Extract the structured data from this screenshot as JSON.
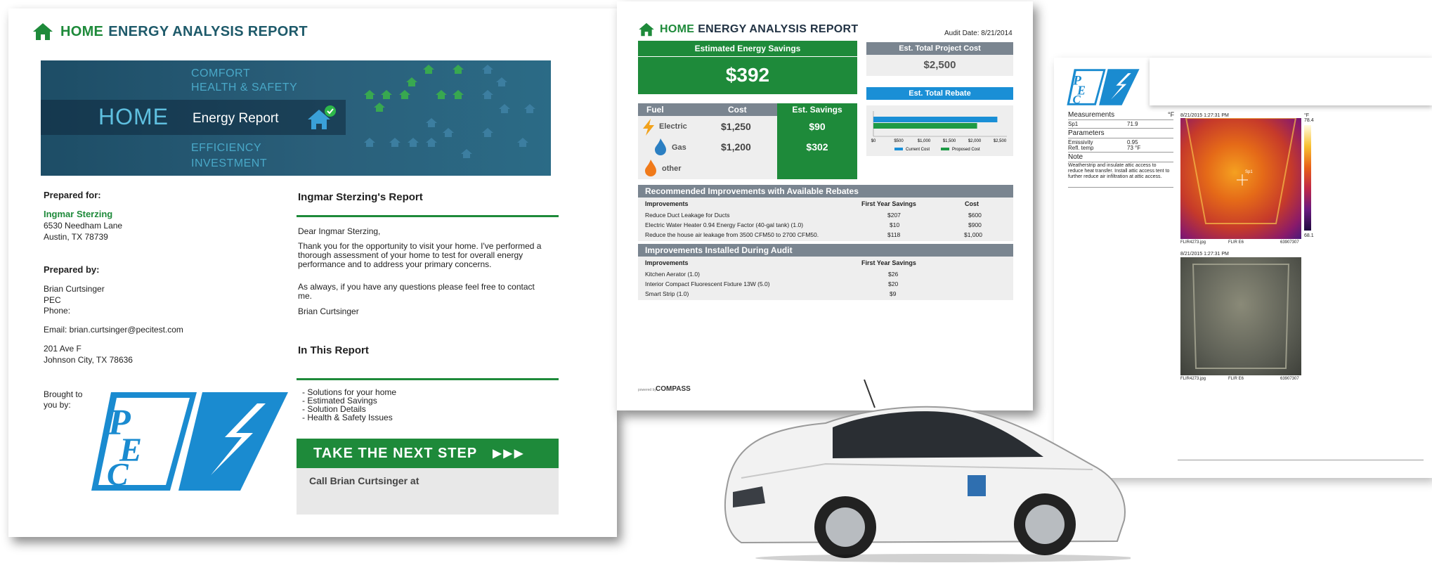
{
  "page1": {
    "brand_home": "HOME",
    "brand_rest": "ENERGY ANALYSIS REPORT",
    "banner": {
      "comfort": "COMFORT",
      "health": "HEALTH & SAFETY",
      "home": "HOME",
      "energy_report": "Energy Report",
      "efficiency": "EFFICIENCY",
      "investment": "INVESTMENT"
    },
    "prepared_for_label": "Prepared for:",
    "client_name": "Ingmar Sterzing",
    "client_address_1": "6530 Needham Lane",
    "client_address_2": "Austin, TX 78739",
    "prepared_by_label": "Prepared by:",
    "auditor_name": "Brian Curtsinger",
    "auditor_org": "PEC",
    "phone_label": "Phone:",
    "email": "Email: brian.curtsinger@pecitest.com",
    "org_address_1": "201 Ave F",
    "org_address_2": "Johnson City, TX 78636",
    "brought_to_you": "Brought to you by:",
    "report_title": "Ingmar Sterzing's Report",
    "greeting": "Dear Ingmar Sterzing,",
    "body_1": "Thank you for the opportunity to visit your home.  I've performed a thorough assessment of your home to test for overall energy performance and to address your primary concerns.",
    "body_2": "As always, if you have any questions please feel free to contact me.",
    "signature": "Brian Curtsinger",
    "in_report_title": "In This Report",
    "in_report_items": [
      "- Solutions for your home",
      "- Estimated Savings",
      "- Solution Details",
      "- Health & Safety Issues"
    ],
    "cta": "TAKE THE NEXT STEP",
    "cta_arrows": "▶▶▶",
    "call_text": "Call Brian Curtsinger at"
  },
  "page2": {
    "brand_home": "HOME",
    "brand_rest": "ENERGY ANALYSIS REPORT",
    "audit_date": "Audit Date: 8/21/2014",
    "savings_label": "Estimated Energy Savings",
    "savings_value": "$392",
    "project_cost_label": "Est. Total Project Cost",
    "project_cost_value": "$2,500",
    "rebate_label": "Est. Total Rebate",
    "fuel_headers": [
      "Fuel",
      "Cost",
      "Est. Savings"
    ],
    "fuel_rows": [
      {
        "fuel": "Electric",
        "cost": "$1,250",
        "savings": "$90"
      },
      {
        "fuel": "Gas",
        "cost": "$1,200",
        "savings": "$302"
      },
      {
        "fuel": "other",
        "cost": "",
        "savings": ""
      }
    ],
    "mini_chart": {
      "ticks": [
        "$0",
        "$500",
        "$1,000",
        "$1,500",
        "$2,000",
        "$2,500"
      ],
      "legend_current": "Current Cost",
      "legend_proposed": "Proposed Cost",
      "current_value": 2450,
      "proposed_value": 2050,
      "max": 2500,
      "current_color": "#1a8fd6",
      "proposed_color": "#1e9a46"
    },
    "rebates_title": "Recommended Improvements with Available Rebates",
    "rebates_headers": [
      "Improvements",
      "First Year Savings",
      "Cost"
    ],
    "rebates_rows": [
      {
        "item": "Reduce Duct Leakage for Ducts",
        "savings": "$207",
        "cost": "$600"
      },
      {
        "item": "Electric Water Heater 0.94 Energy Factor (40-gal tank) (1.0)",
        "savings": "$10",
        "cost": "$900"
      },
      {
        "item": "Reduce the house air leakage from 3500 CFM50 to 2700 CFM50.",
        "savings": "$118",
        "cost": "$1,000"
      }
    ],
    "installed_title": "Improvements Installed During Audit",
    "installed_headers": [
      "Improvements",
      "First Year Savings"
    ],
    "installed_rows": [
      {
        "item": "Kitchen Aerator (1.0)",
        "savings": "$26"
      },
      {
        "item": "Interior Compact Fluorescent Fixture 13W (5.0)",
        "savings": "$20"
      },
      {
        "item": "Smart Strip (1.0)",
        "savings": "$9"
      }
    ],
    "powered_by": "powered by",
    "compass": "COMPASS"
  },
  "page3": {
    "measurements_label": "Measurements",
    "unit": "°F",
    "sp1_label": "Sp1",
    "sp1_value": "71.9",
    "parameters_label": "Parameters",
    "emissivity_label": "Emissivity",
    "emissivity_value": "0.95",
    "reftemp_label": "Refl. temp",
    "reftemp_value": "73 °F",
    "note_label": "Note",
    "note_text": "Weatherstrip and insulate attic access to reduce heat transfer. Install attic access tent to further reduce air infiltration at attic access.",
    "ir_timestamp": "8/21/2015 1:27:31 PM",
    "scale_unit": "°F",
    "scale_max": "78.4",
    "scale_min": "68.1",
    "ir_file": "FLIR4273.jpg",
    "ir_camera": "FLIR E6",
    "ir_serial": "63907307",
    "photo_timestamp": "8/21/2015 1:27:31 PM",
    "photo_file": "FLIR4273.jpg",
    "photo_camera": "FLIR E6",
    "photo_serial": "63907307",
    "sp1_marker": "Sp1"
  }
}
